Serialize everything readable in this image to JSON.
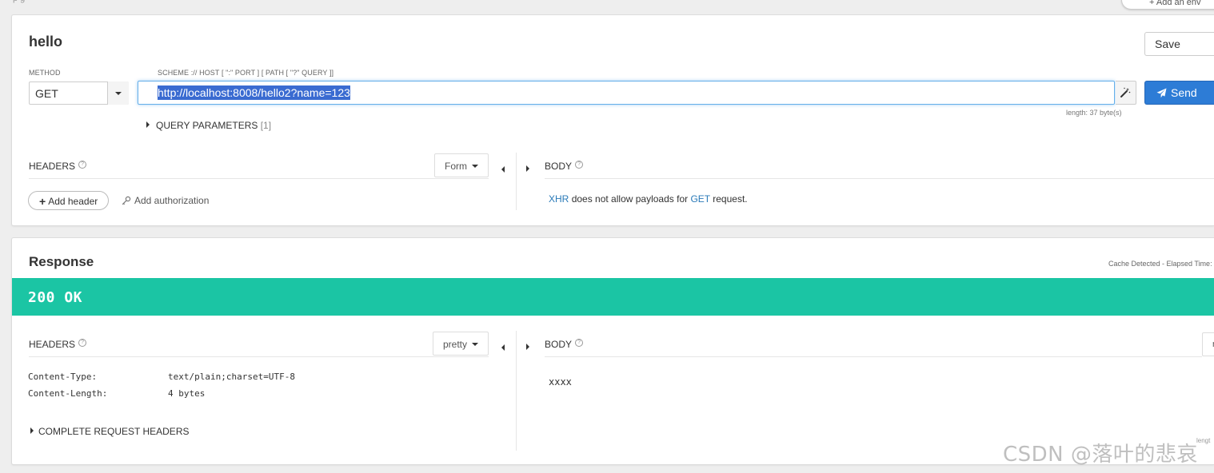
{
  "top": {
    "left_fragment": "p g",
    "env_button": "+ Add an env"
  },
  "request": {
    "title": "hello",
    "save_label": "Save",
    "method_label": "METHOD",
    "method_value": "GET",
    "url_label": "SCHEME :// HOST [ \":\" PORT ] [ PATH [ \"?\" QUERY ]]",
    "url_value": "http://localhost:8008/hello2?name=123",
    "send_label": "Send",
    "length_note": "length: 37 byte(s)",
    "query_params_label": "QUERY PARAMETERS",
    "query_params_count": "[1]",
    "headers_label": "HEADERS",
    "headers_mode": "Form",
    "body_label": "BODY",
    "add_header_label": "Add header",
    "add_authorization_label": "Add authorization",
    "xhr_word": "XHR",
    "xhr_middle": "does not allow payloads for",
    "xhr_method": "GET",
    "xhr_end": "request."
  },
  "response": {
    "title": "Response",
    "cache_note": "Cache Detected - Elapsed Time:",
    "status": "200 OK",
    "headers_label": "HEADERS",
    "headers_mode": "pretty",
    "body_label": "BODY",
    "body_mode_fragment": "r",
    "headers": [
      {
        "name": "Content-Type:",
        "value": "text/plain;charset=UTF-8"
      },
      {
        "name": "Content-Length:",
        "value": "4 bytes"
      }
    ],
    "body_value": "xxxx",
    "complete_headers_label": "COMPLETE REQUEST HEADERS",
    "length_fragment": "lengt"
  },
  "watermark": "CSDN @落叶的悲哀",
  "colors": {
    "status_ok": "#1bc5a4",
    "send_button": "#2d7cd6",
    "link": "#2a7ab8"
  }
}
